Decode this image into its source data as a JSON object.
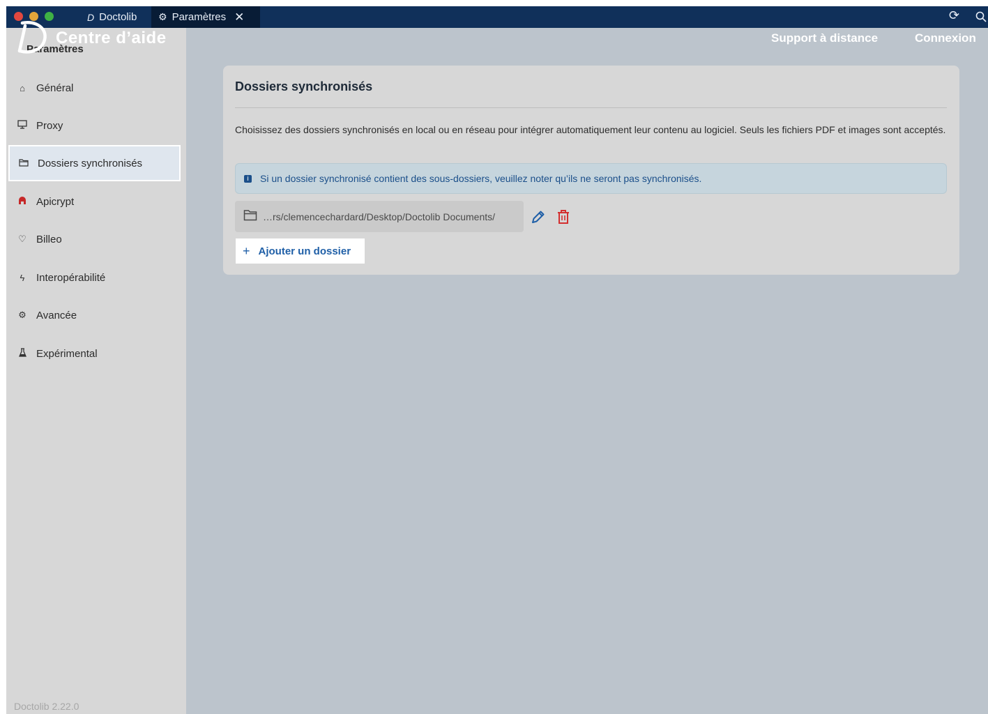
{
  "titlebar": {
    "tabs": [
      {
        "label": "Doctolib",
        "icon": "doctolib-logo-icon"
      },
      {
        "label": "Paramètres",
        "icon": "gear-icon"
      }
    ]
  },
  "overlay": {
    "title": "Centre d’aide",
    "support_link": "Support à distance",
    "login_link": "Connexion"
  },
  "sidebar": {
    "title": "Paramètres",
    "items": [
      {
        "label": "Général",
        "icon": "home-icon"
      },
      {
        "label": "Proxy",
        "icon": "monitor-icon"
      },
      {
        "label": "Dossiers synchronisés",
        "icon": "folder-icon",
        "active": true
      },
      {
        "label": "Apicrypt",
        "icon": "apicrypt-icon"
      },
      {
        "label": "Billeo",
        "icon": "billeo-icon"
      },
      {
        "label": "Interopérabilité",
        "icon": "bolt-icon"
      },
      {
        "label": "Avancée",
        "icon": "gear-icon"
      },
      {
        "label": "Expérimental",
        "icon": "flask-icon"
      }
    ],
    "version": "Doctolib 2.22.0"
  },
  "main": {
    "title": "Dossiers synchronisés",
    "description": "Choisissez des dossiers synchronisés en local ou en réseau pour intégrer automatiquement leur contenu au logiciel. Seuls les fichiers PDF et images sont acceptés.",
    "info": "Si un dossier synchronisé contient des sous-dossiers, veuillez noter qu’ils ne seront pas synchronisés.",
    "folder_path": "…rs/clemencechardard/Desktop/Doctolib Documents/",
    "add_folder_label": "Ajouter un dossier"
  },
  "colors": {
    "titlebar": "#10305a",
    "sidebar": "#d7d7d7",
    "main_background": "#bcc4cc",
    "accent": "#1f5fa7",
    "delete": "#d32f2f"
  }
}
